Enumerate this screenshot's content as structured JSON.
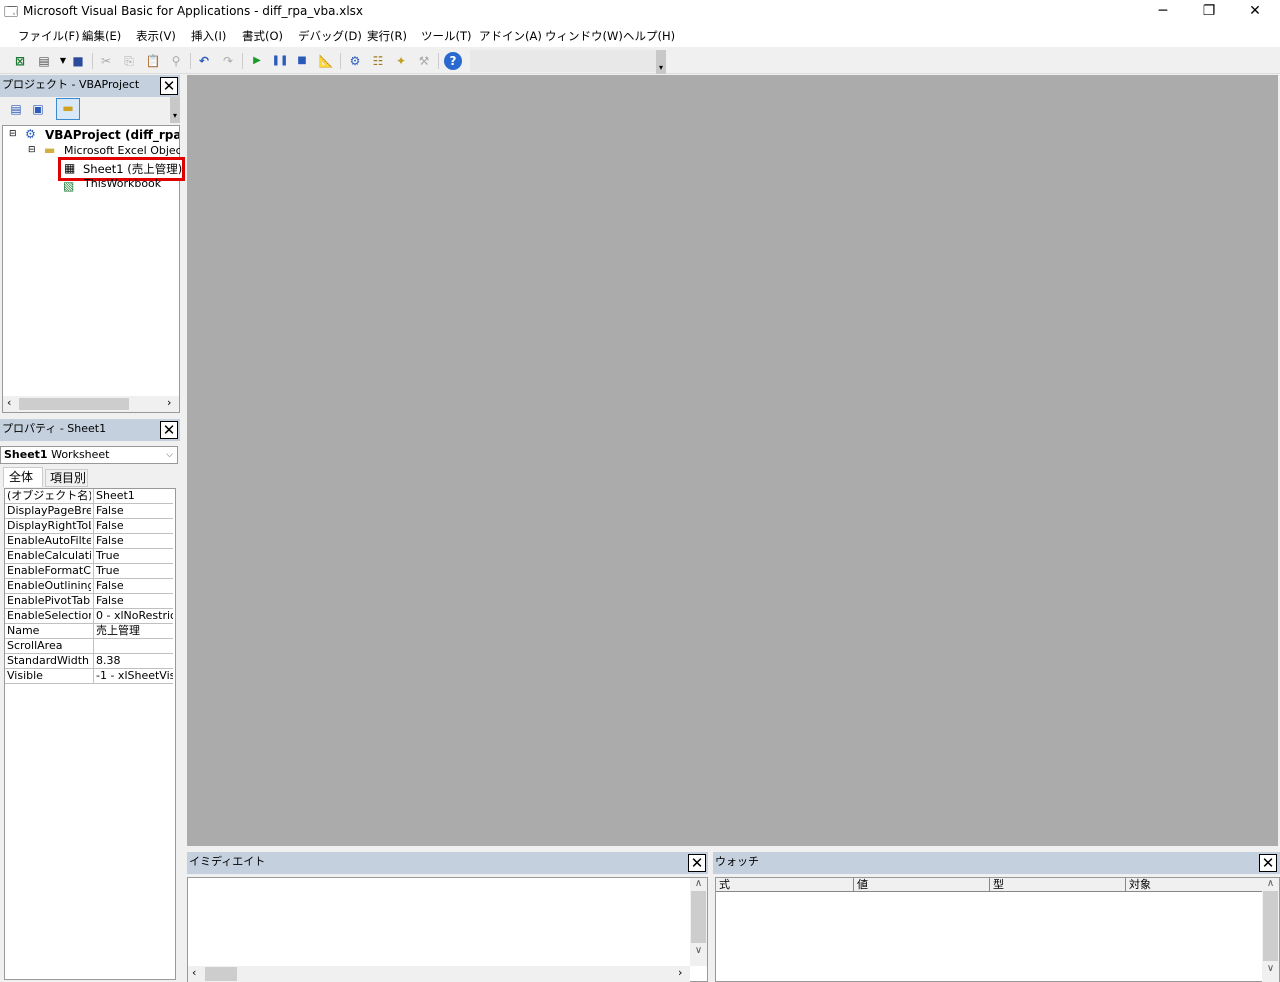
{
  "window": {
    "title": "Microsoft Visual Basic for Applications - diff_rpa_vba.xlsx",
    "minimize": "─",
    "restore": "❐",
    "close": "✕"
  },
  "menu": [
    "ファイル(F)",
    "編集(E)",
    "表示(V)",
    "挿入(I)",
    "書式(O)",
    "デバッグ(D)",
    "実行(R)",
    "ツール(T)",
    "アドイン(A)",
    "ウィンドウ(W)",
    "ヘルプ(H)"
  ],
  "project": {
    "title": "プロジェクト - VBAProject",
    "root": "VBAProject (diff_rpa_v",
    "folder": "Microsoft Excel Objec:",
    "sheet": "Sheet1 (売上管理)",
    "workbook": "ThisWorkbook"
  },
  "properties": {
    "title": "プロパティ - Sheet1",
    "object_name": "Sheet1",
    "object_type": "Worksheet",
    "tabs": [
      "全体",
      "項目別"
    ],
    "rows": [
      [
        "(オブジェクト名)",
        "Sheet1"
      ],
      [
        "DisplayPageBrea",
        "False"
      ],
      [
        "DisplayRightToLe",
        "False"
      ],
      [
        "EnableAutoFilter",
        "False"
      ],
      [
        "EnableCalculatio",
        "True"
      ],
      [
        "EnableFormatCon",
        "True"
      ],
      [
        "EnableOutlining",
        "False"
      ],
      [
        "EnablePivotTable",
        "False"
      ],
      [
        "EnableSelection",
        "0 - xlNoRestric"
      ],
      [
        "Name",
        "売上管理"
      ],
      [
        "ScrollArea",
        ""
      ],
      [
        "StandardWidth",
        "8.38"
      ],
      [
        "Visible",
        "-1 - xlSheetVis"
      ]
    ]
  },
  "immediate": {
    "title": "イミディエイト"
  },
  "watch": {
    "title": "ウォッチ",
    "columns": [
      "式",
      "値",
      "型",
      "対象"
    ]
  },
  "colors": {
    "highlight": "#e00000",
    "workspace": "#ababab",
    "pane_header": "#c4d0de"
  }
}
